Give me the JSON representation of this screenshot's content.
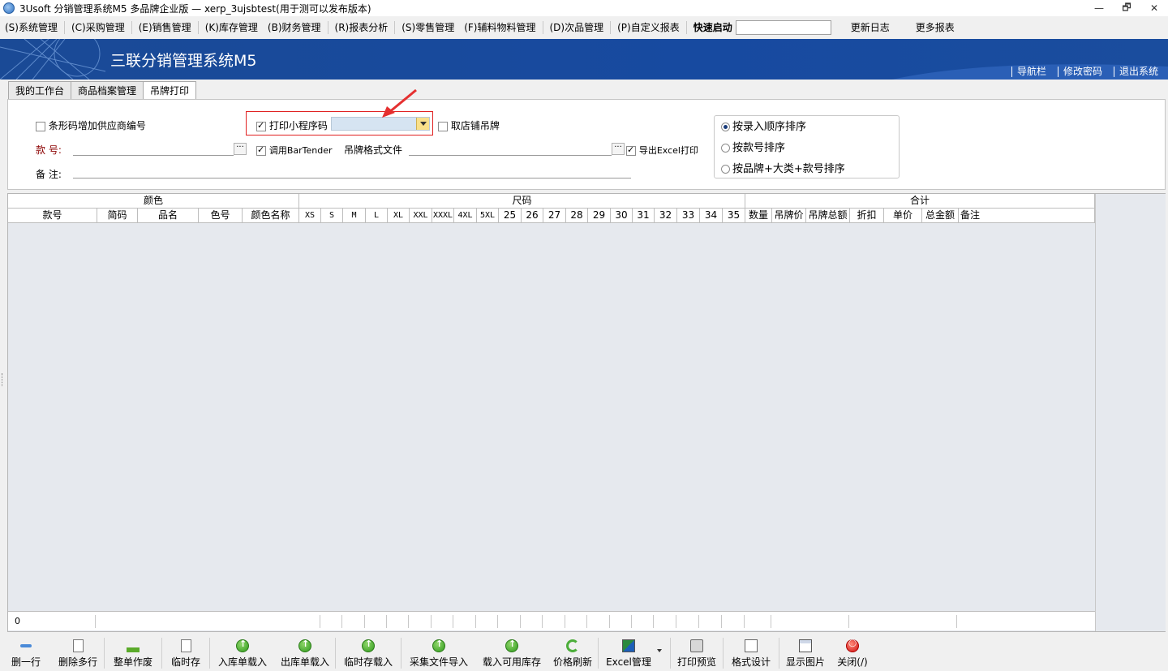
{
  "window": {
    "title": "3Usoft 分销管理系统M5 多品牌企业版 — xerp_3ujsbtest(用于测可以发布版本)",
    "controls": [
      "—",
      "🗗",
      "✕"
    ]
  },
  "menu": {
    "items": [
      "(S)系统管理",
      "(C)采购管理",
      "(E)销售管理",
      "(K)库存管理",
      "(B)财务管理",
      "(R)报表分析",
      "(S)零售管理",
      "(F)辅料物料管理",
      "(D)次品管理",
      "(P)自定义报表"
    ],
    "quick_label": "快速启动",
    "quick_value": "",
    "extra": [
      "更新日志",
      "更多报表"
    ]
  },
  "banner": {
    "title": "三联分销管理系统M5",
    "links": [
      "导航栏",
      "修改密码",
      "退出系统"
    ]
  },
  "tabs": [
    "我的工作台",
    "商品档案管理",
    "吊牌打印"
  ],
  "form": {
    "barcode_supplier": {
      "label": "条形码增加供应商编号",
      "checked": false
    },
    "print_miniprogram": {
      "label": "打印小程序码",
      "checked": true,
      "value": ""
    },
    "store_tag": {
      "label": "取店铺吊牌",
      "checked": false
    },
    "style_no_label": "款  号:",
    "style_no_value": "",
    "remark_label": "备  注:",
    "remark_value": "",
    "bartender": {
      "label": "调用BarTender",
      "checked": true
    },
    "tag_format_label": "吊牌格式文件",
    "tag_format_value": "",
    "export_excel": {
      "label": "导出Excel打印",
      "checked": true
    },
    "dots": "···",
    "sort_options": [
      {
        "label": "按录入顺序排序",
        "selected": true
      },
      {
        "label": "按款号排序",
        "selected": false
      },
      {
        "label": "按品牌+大类+款号排序",
        "selected": false
      }
    ]
  },
  "grid": {
    "groups": [
      "颜色",
      "尺码",
      "合计"
    ],
    "columns_color": [
      "款号",
      "简码",
      "品名",
      "色号",
      "颜色名称"
    ],
    "columns_size": [
      "XS",
      "S",
      "M",
      "L",
      "XL",
      "XXL",
      "XXXL",
      "4XL",
      "5XL",
      "25",
      "26",
      "27",
      "28",
      "29",
      "30",
      "31",
      "32",
      "33",
      "34",
      "35"
    ],
    "columns_total": [
      "数量",
      "吊牌价",
      "吊牌总额",
      "折扣",
      "单价",
      "总金额",
      "备注"
    ],
    "footer_count": "0"
  },
  "toolbar": [
    "删一行",
    "删除多行",
    "整单作废",
    "临时存",
    "入库单载入",
    "出库单载入",
    "临时存载入",
    "采集文件导入",
    "载入可用库存",
    "价格刷新",
    "Excel管理",
    "打印预览",
    "格式设计",
    "显示图片",
    "关闭(/)"
  ],
  "colors": {
    "banner": "#174aa0",
    "highlight_border": "#e02020",
    "arrow": "#e53030",
    "grid_bg": "#e6e9ee"
  }
}
